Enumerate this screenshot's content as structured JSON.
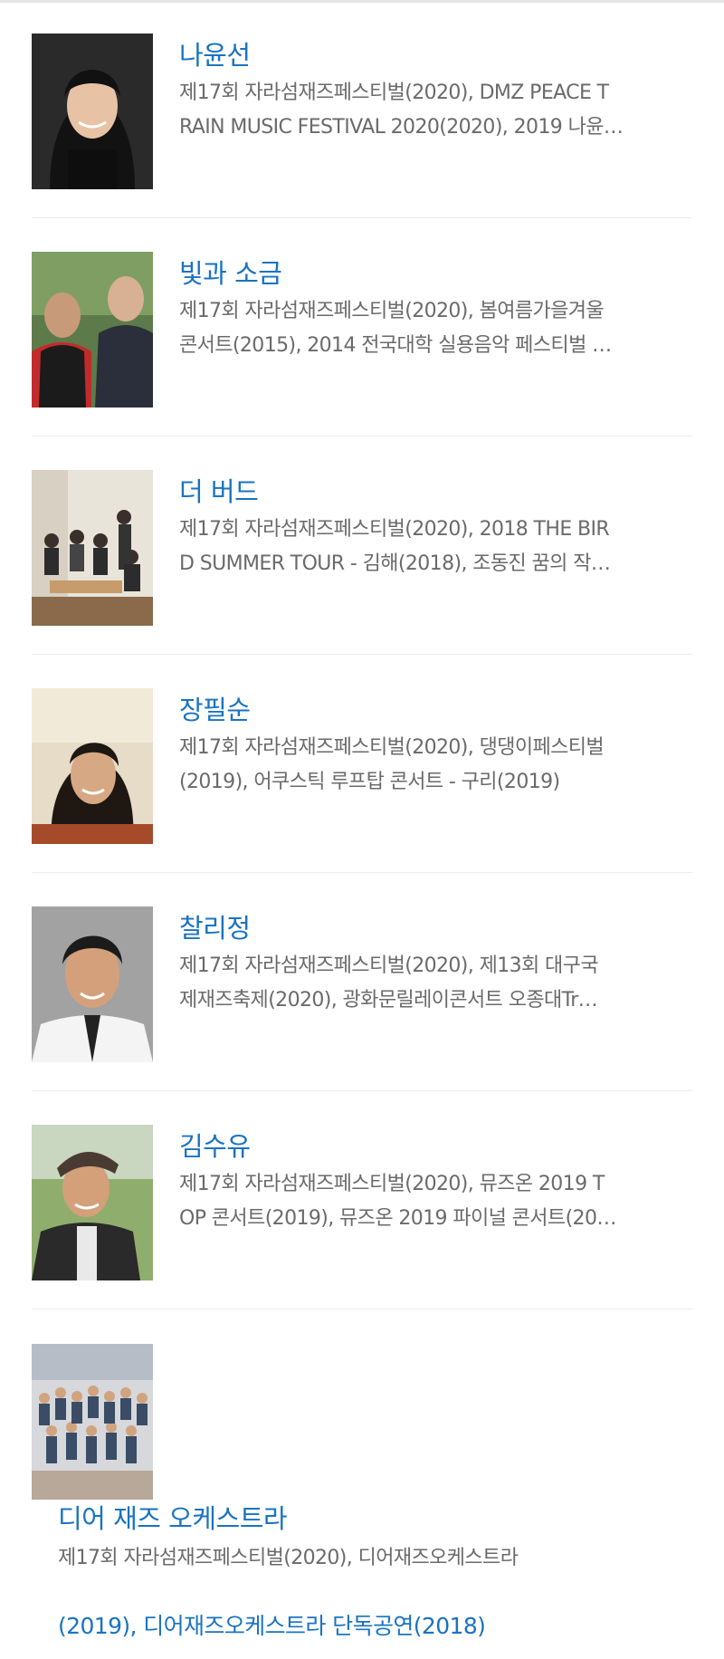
{
  "artists": [
    {
      "name": "나윤선",
      "desc_line1": "제17회 자라섬재즈페스티벌(2020), DMZ PEACE T",
      "desc_line2": "RAIN MUSIC FESTIVAL 2020(2020), 2019 나윤…"
    },
    {
      "name": "빛과 소금",
      "desc_line1": "제17회 자라섬재즈페스티벌(2020), 봄여름가을겨울",
      "desc_line2": "콘서트(2015), 2014 전국대학 실용음악 페스티벌 …"
    },
    {
      "name": "더 버드",
      "desc_line1": "제17회 자라섬재즈페스티벌(2020), 2018 THE BIR",
      "desc_line2": "D SUMMER TOUR - 김해(2018), 조동진 꿈의 작…"
    },
    {
      "name": "장필순",
      "desc_line1": "제17회 자라섬재즈페스티벌(2020), 댕댕이페스티벌",
      "desc_line2": "(2019), 어쿠스틱 루프탑 콘서트 - 구리(2019)"
    },
    {
      "name": "찰리정",
      "desc_line1": "제17회 자라섬재즈페스티벌(2020), 제13회 대구국",
      "desc_line2": "제재즈축제(2020), 광화문릴레이콘서트 오종대Tr…"
    },
    {
      "name": "김수유",
      "desc_line1": "제17회 자라섬재즈페스티벌(2020), 뮤즈온 2019 T",
      "desc_line2": "OP 콘서트(2019), 뮤즈온 2019 파이널 콘서트(20…"
    }
  ],
  "last_artist": {
    "name": "디어 재즈 오케스트라",
    "desc_line1": "제17회 자라섬재즈페스티벌(2020), 디어재즈오케스트라",
    "desc_line2": "(2019), 디어재즈오케스트라 단독공연(2018)"
  }
}
